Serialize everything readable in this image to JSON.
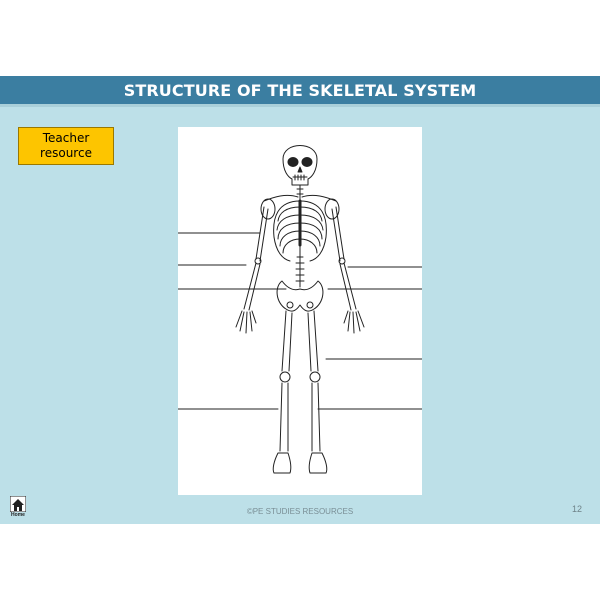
{
  "slide": {
    "title": "STRUCTURE OF THE SKELETAL SYSTEM",
    "teacher_box": {
      "line1": "Teacher",
      "line2": "resource"
    },
    "footer": "©PE STUDIES RESOURCES",
    "page_number": "12",
    "home_button": {
      "label": "Home",
      "icon": "home-icon"
    }
  },
  "colors": {
    "title_bar": "#3b7ea1",
    "slide_background": "#bde0e8",
    "teacher_box": "#fdc500"
  }
}
